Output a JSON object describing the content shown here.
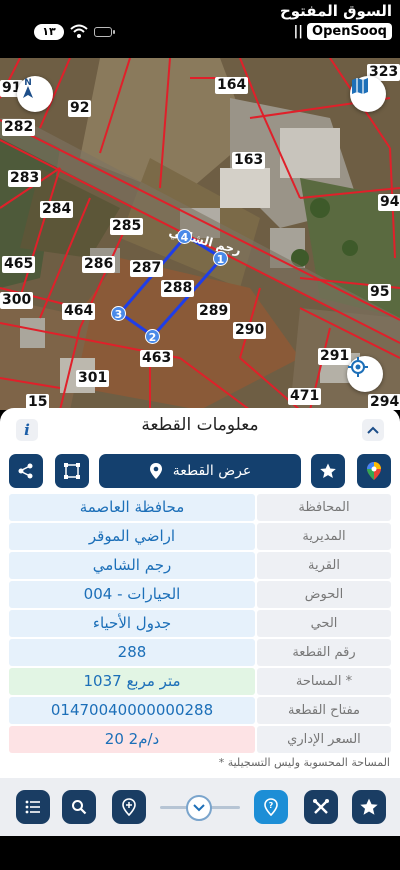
{
  "status_bar": {
    "notification_count": "١٣"
  },
  "brand": {
    "arabic_name": "السوق المفتوح",
    "english_name": "OpenSooq",
    "bars": "||"
  },
  "map": {
    "street_label": "رجم الشامي",
    "parcel_labels": [
      "91",
      "164",
      "323",
      "92",
      "282",
      "163",
      "283",
      "94",
      "284",
      "285",
      "286",
      "287",
      "465",
      "288",
      "289",
      "95",
      "300",
      "464",
      "290",
      "463",
      "291",
      "301",
      "471",
      "15",
      "294"
    ],
    "vertices": [
      "1",
      "2",
      "3",
      "4"
    ],
    "north_icon": "north-arrow-icon",
    "layers_icon": "map-layers-icon",
    "locate_icon": "locate-icon",
    "selection_color": "#1f3ee8",
    "boundary_color": "#e0202a"
  },
  "panel": {
    "title": "معلومات القطعة",
    "info_label": "i",
    "show_parcel_label": "عرض القطعة",
    "rows": [
      {
        "label": "المحافظة",
        "value": "محافظة العاصمة"
      },
      {
        "label": "المديرية",
        "value": "اراضي الموقر"
      },
      {
        "label": "القرية",
        "value": "رجم الشامي"
      },
      {
        "label": "الحوض",
        "value": "الحيارات - 004"
      },
      {
        "label": "الحي",
        "value": "جدول الأحياء"
      },
      {
        "label": "رقم القطعة",
        "value": "288"
      },
      {
        "label": "المساحة *",
        "value": "1037   متر مربع"
      },
      {
        "label": "مفتاح القطعة",
        "value": "01470040000000288"
      },
      {
        "label": "السعر الإداري",
        "value": "20 د/م2"
      }
    ],
    "footnote": "* المساحة المحسوبة وليس التسجيلية"
  },
  "colors": {
    "navy": "#14406e",
    "accent_blue": "#1d8ed6",
    "value_text": "#1c6fb8"
  }
}
